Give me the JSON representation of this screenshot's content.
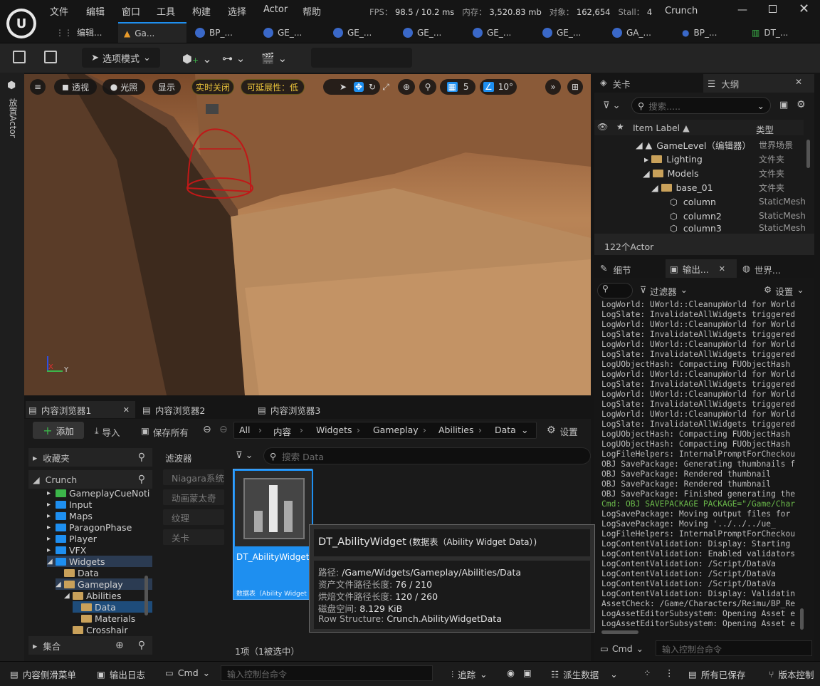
{
  "app": {
    "menu": [
      "文件",
      "编辑",
      "窗口",
      "工具",
      "构建",
      "选择",
      "Actor",
      "帮助"
    ],
    "stats": {
      "fps_label": "FPS：",
      "fps": "98.5",
      "frame": "/ 10.2 ms",
      "mem_label": "内存：",
      "mem": "3,520.83 mb",
      "obj_label": "对象：",
      "obj": "162,654",
      "stall_label": "Stall：",
      "stall": "4"
    },
    "project": "Crunch",
    "tabs": [
      "编辑...",
      "Ga...",
      "BP_...",
      "GE_...",
      "GE_...",
      "GE_...",
      "GE_...",
      "GE_...",
      "GA_...",
      "BP_...",
      "DT_..."
    ]
  },
  "toolbar": {
    "mode_label": "选项模式",
    "platform_label": "平台",
    "settings_label": "设置"
  },
  "leftbar": {
    "place_actor": "放置Actor"
  },
  "viewport": {
    "perspective": "透视",
    "lit": "光照",
    "show": "显示",
    "realtime_off": "实时关闭",
    "scalability": "可延展性：低",
    "grid_snap": "5",
    "rot_snap": "10°",
    "axis_x": "X",
    "axis_y": "Y"
  },
  "outliner": {
    "tab_level": "关卡",
    "tab_outliner": "大纲",
    "search_placeholder": "搜索.....",
    "col_label": "Item Label ▲",
    "col_type": "类型",
    "rows": [
      {
        "label": "GameLevel（编辑器）",
        "type": "世界场景"
      },
      {
        "label": "Lighting",
        "type": "文件夹"
      },
      {
        "label": "Models",
        "type": "文件夹"
      },
      {
        "label": "base_01",
        "type": "文件夹"
      },
      {
        "label": "column",
        "type": "StaticMesh"
      },
      {
        "label": "column2",
        "type": "StaticMesh"
      },
      {
        "label": "column3",
        "type": "StaticMesh"
      }
    ],
    "count": "122个Actor"
  },
  "output": {
    "tab_details": "细节",
    "tab_output": "输出...",
    "tab_world": "世界...",
    "filter_label": "过滤器",
    "settings_label": "设置",
    "lines": [
      "LogWorld: UWorld::CleanupWorld for World",
      "LogSlate: InvalidateAllWidgets triggered",
      "LogWorld: UWorld::CleanupWorld for World",
      "LogSlate: InvalidateAllWidgets triggered",
      "LogWorld: UWorld::CleanupWorld for World",
      "LogSlate: InvalidateAllWidgets triggered",
      "LogUObjectHash: Compacting FUObjectHash",
      "LogWorld: UWorld::CleanupWorld for World",
      "LogSlate: InvalidateAllWidgets triggered",
      "LogWorld: UWorld::CleanupWorld for World",
      "LogSlate: InvalidateAllWidgets triggered",
      "LogWorld: UWorld::CleanupWorld for World",
      "LogSlate: InvalidateAllWidgets triggered",
      "LogUObjectHash: Compacting FUObjectHash",
      "LogUObjectHash: Compacting FUObjectHash",
      "LogFileHelpers: InternalPromptForCheckou",
      "OBJ SavePackage: Generating thumbnails f",
      "OBJ SavePackage:     Rendered thumbnail",
      "OBJ SavePackage:     Rendered thumbnail",
      "OBJ SavePackage: Finished generating the",
      "Cmd: OBJ SAVEPACKAGE PACKAGE=\"/Game/Char",
      "LogSavePackage: Moving output files for",
      "LogSavePackage: Moving '../../../ue_",
      "LogFileHelpers: InternalPromptForCheckou",
      "LogContentValidation: Display: Starting",
      "LogContentValidation: Enabled validators",
      "LogContentValidation:     /Script/DataVa",
      "LogContentValidation:     /Script/DataVa",
      "LogContentValidation:     /Script/DataVa",
      "LogContentValidation: Display: Validatin",
      "AssetCheck: /Game/Characters/Reimu/BP_Re",
      "LogAssetEditorSubsystem: Opening Asset e",
      "LogAssetEditorSubsystem: Opening Asset e"
    ],
    "cmd_label": "Cmd",
    "cmd_placeholder": "输入控制台命令"
  },
  "content_browser": {
    "tabs": [
      "内容浏览器1",
      "内容浏览器2",
      "内容浏览器3"
    ],
    "add_label": "添加",
    "import_label": "导入",
    "save_all_label": "保存所有",
    "settings_label": "设置",
    "breadcrumb": [
      "All",
      "内容",
      "Widgets",
      "Gameplay",
      "Abilities",
      "Data"
    ],
    "favorites": "收藏夹",
    "root": "Crunch",
    "filters_title": "滤波器",
    "filters": [
      "Niagara系统",
      "动画蒙太奇",
      "纹理",
      "关卡"
    ],
    "search_placeholder": "搜索 Data",
    "tree": [
      {
        "label": "GameplayCueNoti",
        "indent": 0
      },
      {
        "label": "Input",
        "indent": 0
      },
      {
        "label": "Maps",
        "indent": 0
      },
      {
        "label": "ParagonPhase",
        "indent": 0
      },
      {
        "label": "Player",
        "indent": 0
      },
      {
        "label": "VFX",
        "indent": 0
      },
      {
        "label": "Widgets",
        "indent": 0
      },
      {
        "label": "Data",
        "indent": 1
      },
      {
        "label": "Gameplay",
        "indent": 1
      },
      {
        "label": "Abilities",
        "indent": 2
      },
      {
        "label": "Data",
        "indent": 3
      },
      {
        "label": "Materials",
        "indent": 3
      },
      {
        "label": "Crosshair",
        "indent": 2
      }
    ],
    "collections": "集合",
    "asset": {
      "name": "DT_AbilityWidget",
      "type": "数据表（Ability Widget D..."
    },
    "count": "1项（1被选中）"
  },
  "tooltip": {
    "title": "DT_AbilityWidget",
    "subtitle": "(数据表（Ability Widget Data）)",
    "path_label": "路径:",
    "path": "/Game/Widgets/Gameplay/Abilities/Data",
    "asset_len_label": "资产文件路径长度:",
    "asset_len": "76 / 210",
    "cooked_len_label": "烘焙文件路径长度:",
    "cooked_len": "120 / 260",
    "disk_label": "磁盘空间:",
    "disk": "8.129 KiB",
    "row_label": "Row Structure:",
    "row": "Crunch.AbilityWidgetData"
  },
  "statusbar": {
    "drawer": "内容侧滑菜单",
    "output_log": "输出日志",
    "cmd": "Cmd",
    "cmd_placeholder": "输入控制台命令",
    "trace": "追踪",
    "derived": "派生数据",
    "all_saved": "所有已保存",
    "version": "版本控制"
  },
  "colors": {
    "accent_blue": "#1e8ff0",
    "play_green": "#3cb64a",
    "folder": "#c9a15a",
    "yellow": "#e8c23a"
  }
}
